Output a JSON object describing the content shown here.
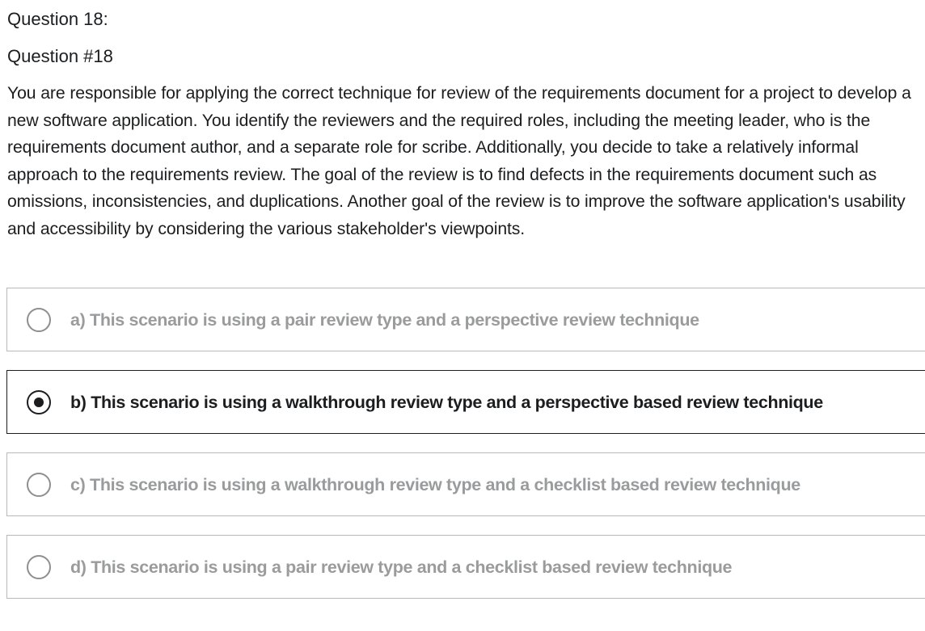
{
  "question": {
    "title": "Question 18:",
    "number": "Question #18",
    "text": "You are responsible for applying the correct technique for review of the requirements document for a project to develop a new software application. You identify the reviewers and the required roles, including the meeting leader, who is the requirements document author, and a separate role for scribe. Additionally, you decide to take a relatively informal approach to the requirements review. The goal of the review is to find defects in the requirements document such as omissions, inconsistencies, and duplications. Another goal of the review is to improve the software application's usability and accessibility by considering the various stakeholder's viewpoints."
  },
  "options": [
    {
      "label": "a) This scenario is using a pair review type and a perspective review technique",
      "selected": false
    },
    {
      "label": "b) This scenario is using a walkthrough review type and a perspective based review technique",
      "selected": true
    },
    {
      "label": "c) This scenario is using a walkthrough review type and a checklist based review technique",
      "selected": false
    },
    {
      "label": "d) This scenario is using a pair review type and a checklist based review technique",
      "selected": false
    }
  ],
  "colors": {
    "text": "#1c1d1f",
    "muted_text": "#9a9b9c",
    "border": "#b8b9ba",
    "selected_border": "#1c1d1f"
  },
  "icons": {
    "radio_unselected": "radio-unselected-icon",
    "radio_selected": "radio-selected-icon"
  }
}
